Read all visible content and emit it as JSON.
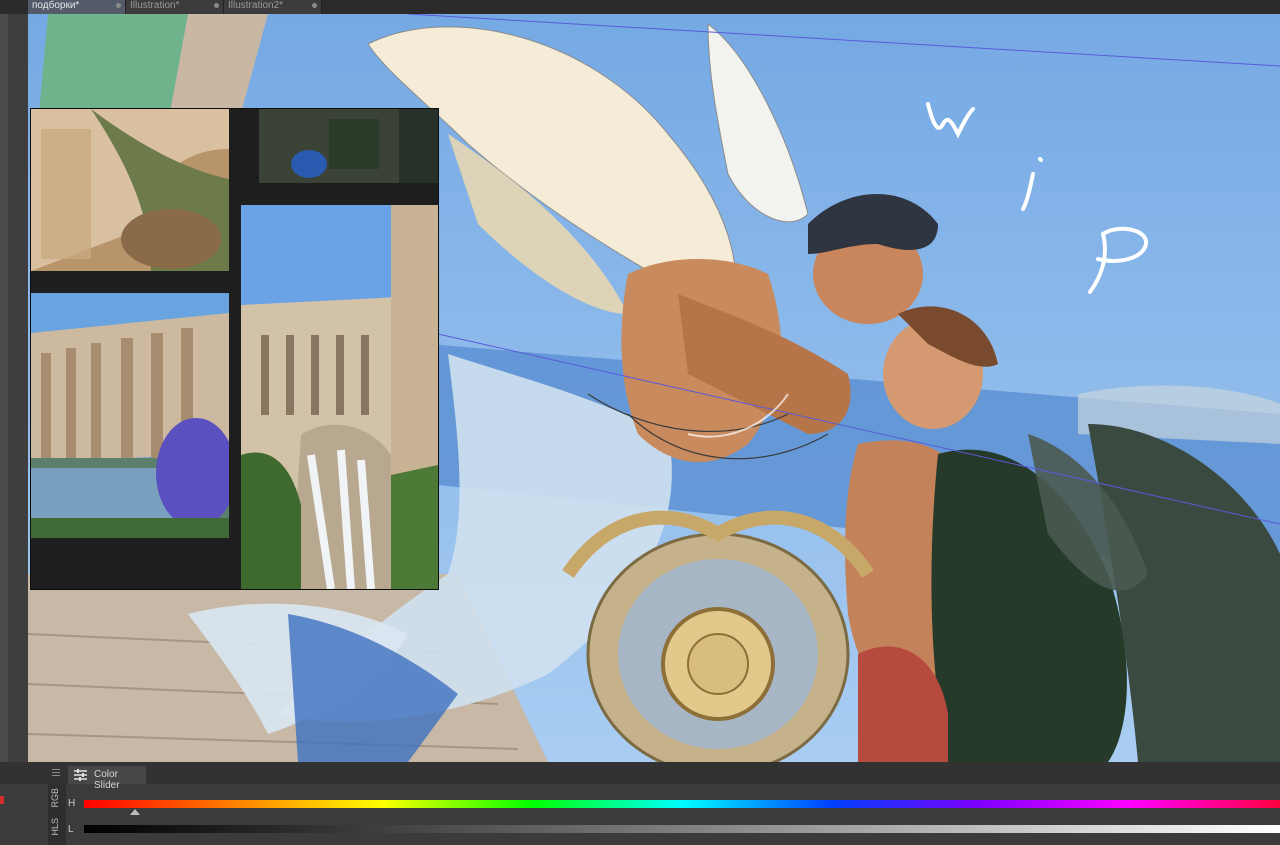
{
  "tabs": [
    {
      "label": "подборки*",
      "active": true
    },
    {
      "label": "Illustration*",
      "active": false
    },
    {
      "label": "Illustration2*",
      "active": false
    }
  ],
  "canvas": {
    "handwritten_text": "wip"
  },
  "panel": {
    "title": "Color Slider",
    "modes": [
      "RGB",
      "HLS"
    ],
    "channels": [
      {
        "label": "H"
      },
      {
        "label": "L"
      }
    ],
    "hue_position": 0.04,
    "lightness_position": 0.0
  },
  "colors": {
    "sky": "#7fb0e6",
    "hue_start": "#ff0000",
    "panel_bg": "#3b3b3b",
    "active_tab": "#535b6b"
  }
}
